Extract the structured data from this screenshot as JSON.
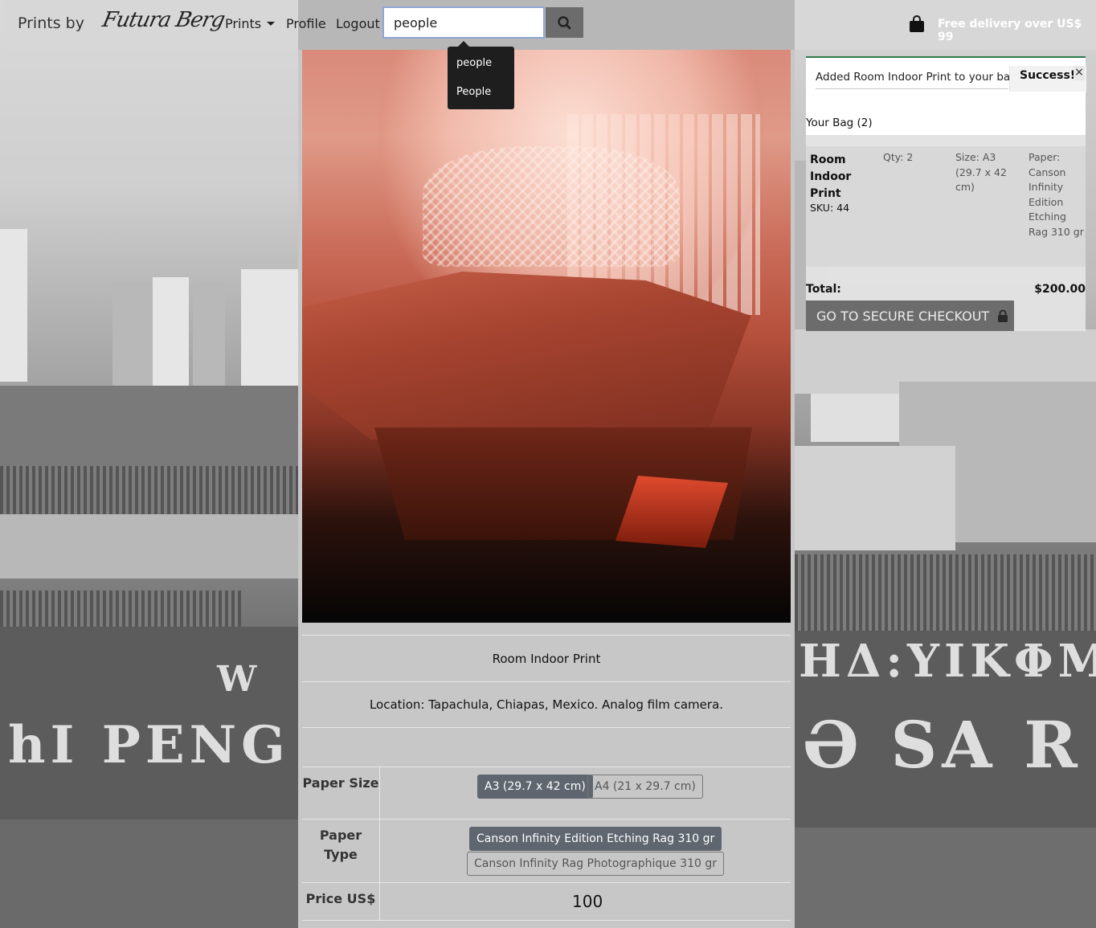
{
  "navbar": {
    "brand_text": "Prints by",
    "brand_signature": "Futura Berg",
    "links": [
      {
        "label": "Prints",
        "has_caret": true
      },
      {
        "label": "Profile"
      },
      {
        "label": "Logout"
      }
    ],
    "search": {
      "value": "people",
      "button_icon": "search-icon"
    },
    "bag_icon": "shopping-bag-icon",
    "free_delivery": "Free delivery over US$ 99"
  },
  "search_suggestions": [
    "people",
    "People"
  ],
  "product": {
    "title": "Room Indoor Print",
    "description": "Location: Tapachula, Chiapas, Mexico. Analog film camera.",
    "options": {
      "paper_size_label": "Paper Size",
      "paper_sizes": [
        {
          "label": "A3 (29.7 x 42 cm)",
          "selected": true
        },
        {
          "label": "A4 (21 x 29.7 cm)",
          "selected": false
        }
      ],
      "paper_type_label": "Paper Type",
      "paper_types": [
        {
          "label": "Canson Infinity Edition Etching Rag 310 gr",
          "selected": true
        },
        {
          "label": "Canson Infinity Rag Photographique 310 gr",
          "selected": false
        }
      ],
      "price_label": "Price US$",
      "price_value": "100"
    }
  },
  "toast": {
    "message": "Added Room Indoor Print to your bag",
    "title": "Success!",
    "close": "×",
    "accent_color": "#2d7a4a"
  },
  "bag": {
    "heading": "Your Bag (2)",
    "item": {
      "name": "Room Indoor Print",
      "sku": "SKU: 44",
      "qty": "Qty: 2",
      "size": "Size: A3 (29.7 x 42 cm)",
      "paper": "Paper: Canson Infinity Edition Etching Rag 310 gr"
    },
    "total_label": "Total:",
    "total_value": "$200.00",
    "checkout_label": "GO TO SECURE CHECKOUT",
    "checkout_icon": "lock-icon"
  }
}
